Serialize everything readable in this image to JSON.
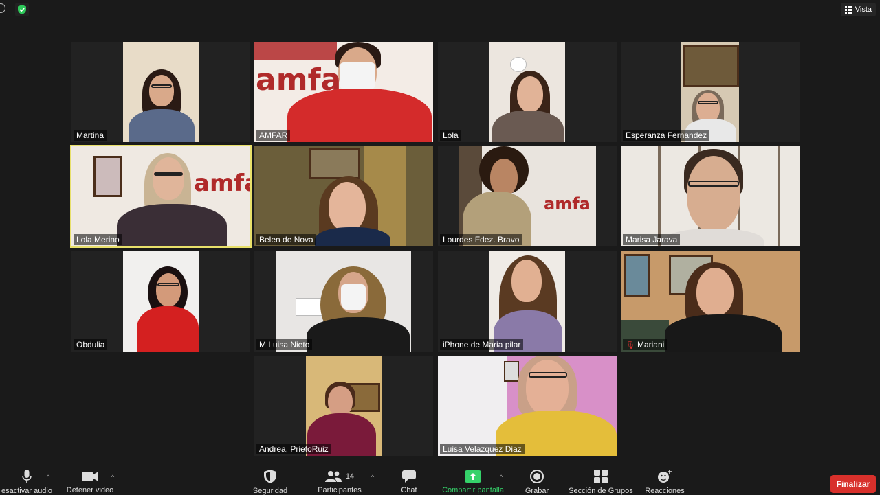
{
  "top": {
    "view_label": "Vista"
  },
  "participants": [
    {
      "name": "Martina"
    },
    {
      "name": "AMFAR"
    },
    {
      "name": "Lola"
    },
    {
      "name": "Esperanza Fernandez"
    },
    {
      "name": "Lola Merino"
    },
    {
      "name": "Belen de Nova"
    },
    {
      "name": "Lourdes Fdez. Bravo"
    },
    {
      "name": "Marisa Jarava"
    },
    {
      "name": "Obdulia"
    },
    {
      "name": "M Luisa Nieto"
    },
    {
      "name": "iPhone de Maria pilar"
    },
    {
      "name": "Mariani"
    },
    {
      "name": "Andrea, PrietoRuiz"
    },
    {
      "name": "Luisa Velazquez Diaz"
    }
  ],
  "toolbar": {
    "mute_label": "esactivar audio",
    "video_label": "Detener video",
    "security_label": "Seguridad",
    "participants_label": "Participantes",
    "participants_count": "14",
    "chat_label": "Chat",
    "share_label": "Compartir pantalla",
    "record_label": "Grabar",
    "breakout_label": "Sección de Grupos",
    "reactions_label": "Reacciones",
    "end_label": "Finalizar"
  },
  "colors": {
    "active_speaker_border": "#e8e06a",
    "share_green": "#35d26a",
    "end_red": "#d8302b"
  }
}
